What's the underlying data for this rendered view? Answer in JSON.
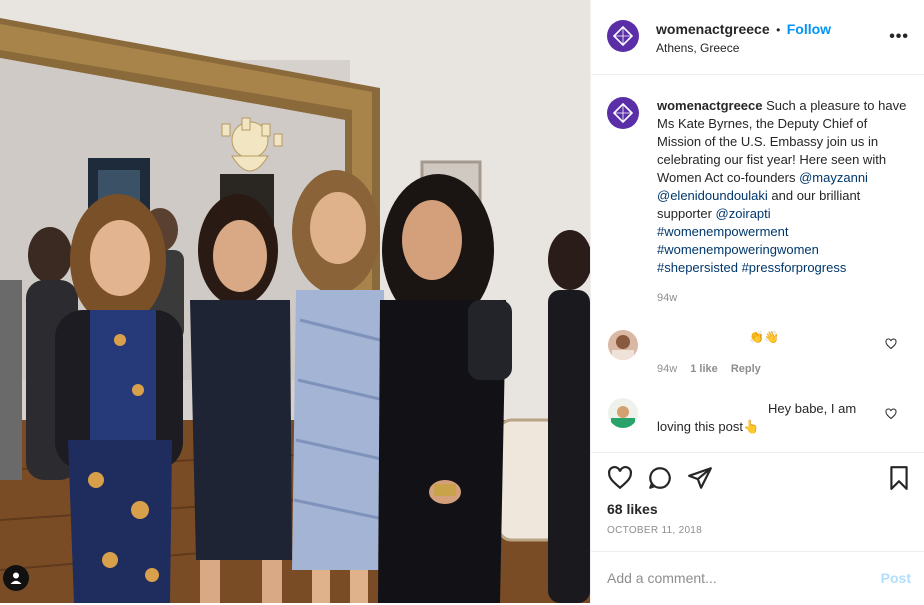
{
  "post": {
    "username": "womenactgreece",
    "follow_separator": "•",
    "follow_label": "Follow",
    "location": "Athens, Greece",
    "more_label": "•••"
  },
  "caption": {
    "username": "womenactgreece",
    "text_1": " Such a pleasure to have Ms Kate Byrnes, the Deputy Chief of Mission of the U.S. Embassy join us in celebrating our fist year! Here seen with Women Act co-founders ",
    "mention_1": "@mayzanni",
    "mention_2": "@elenidoundoulaki",
    "text_2": " and our brilliant supporter ",
    "mention_3": "@zoirapti",
    "hashtag_1": "#womenempowerment",
    "hashtag_2": "#womenempoweringwomen",
    "hashtag_3": "#shepersisted",
    "hashtag_4": "#pressforprogress",
    "age": "94w"
  },
  "comments": [
    {
      "text": "👏👋",
      "age": "94w",
      "likes": "1 like",
      "reply": "Reply"
    },
    {
      "text_1": "Hey babe, I am",
      "text_2": "loving this post👆"
    }
  ],
  "actions": {
    "likes": "68 likes",
    "date": "OCTOBER 11, 2018"
  },
  "add_comment": {
    "placeholder": "Add a comment...",
    "post_label": "Post"
  },
  "colors": {
    "brand_purple": "#5a2ea6",
    "link_blue": "#0095f6",
    "hashtag_blue": "#00376b",
    "post_disabled": "#b2dffc"
  }
}
